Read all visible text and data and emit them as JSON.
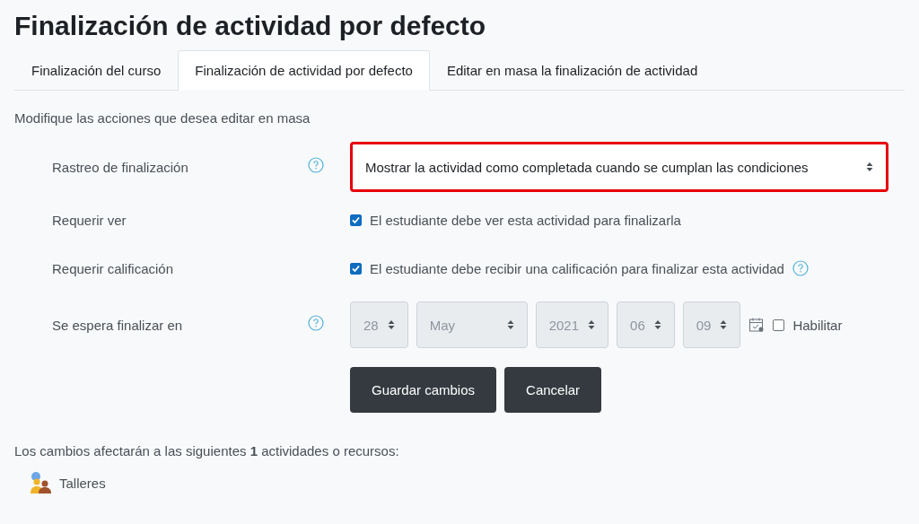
{
  "title": "Finalización de actividad por defecto",
  "tabs": [
    {
      "label": "Finalización del curso",
      "selected": false
    },
    {
      "label": "Finalización de actividad por defecto",
      "selected": true
    },
    {
      "label": "Editar en masa la finalización de actividad",
      "selected": false
    }
  ],
  "instructions": "Modifique las acciones que desea editar en masa",
  "fields": [
    {
      "kind": "select",
      "label": "Rastreo de finalización",
      "help": true,
      "value": "Mostrar la actividad como completada cuando se cumplan las condiciones",
      "highlighted": true
    },
    {
      "kind": "checkbox",
      "label": "Requerir ver",
      "help": false,
      "checked": true,
      "text": "El estudiante debe ver esta actividad para finalizarla",
      "text_help": false
    },
    {
      "kind": "checkbox",
      "label": "Requerir calificación",
      "help": false,
      "checked": true,
      "text": "El estudiante debe recibir una calificación para finalizar esta actividad",
      "text_help": true
    },
    {
      "kind": "date",
      "label": "Se espera finalizar en",
      "help": true,
      "disabled": true,
      "parts": [
        "28",
        "May",
        "2021",
        "06",
        "09"
      ],
      "enable_label": "Habilitar",
      "enable_checked": false
    }
  ],
  "buttons": [
    "Guardar cambios",
    "Cancelar"
  ],
  "affected": "Los cambios afectarán a las siguientes **1** actividades o recursos:",
  "activities": [
    {
      "name": "Talleres"
    }
  ]
}
